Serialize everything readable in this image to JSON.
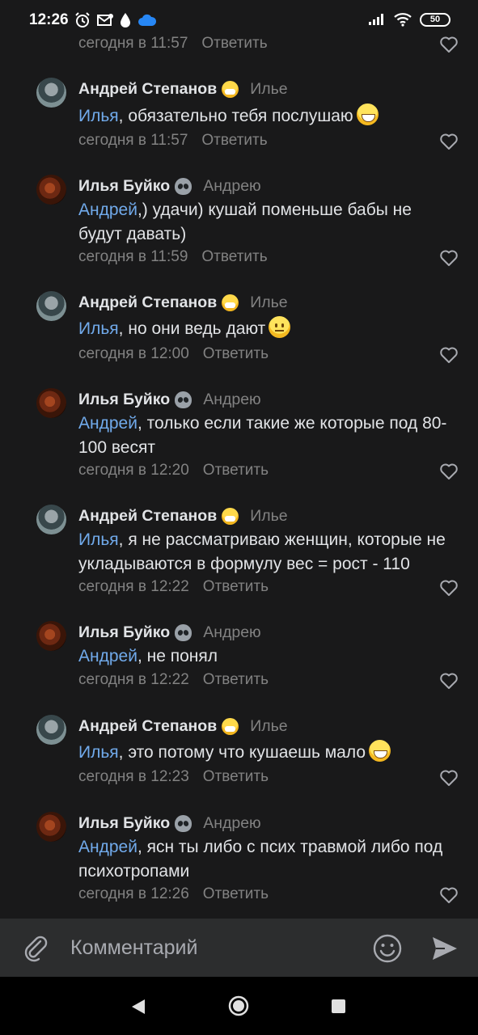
{
  "status_bar": {
    "time": "12:26",
    "battery": "50",
    "left_icons": [
      "alarm-icon",
      "mail-icon",
      "drop-icon",
      "cloud-icon"
    ],
    "right_icons": [
      "signal-icon",
      "wifi-icon",
      "battery-icon"
    ]
  },
  "colors": {
    "background": "#19191a",
    "mention": "#71aaeb",
    "meta": "#828282",
    "input_bar": "#2c2d2e"
  },
  "top_partial_comment": {
    "time": "сегодня в 11:57",
    "reply_label": "Ответить"
  },
  "comments": [
    {
      "author": "Андрей Степанов",
      "badge": "mask-emoji",
      "reply_to": "Илье",
      "mention": "Илья",
      "text": ", обязательно тебя послушаю",
      "emoji": "grin",
      "time": "сегодня в 11:57",
      "reply_label": "Ответить"
    },
    {
      "author": "Илья Буйко",
      "badge": "alien-emoji",
      "reply_to": "Андрею",
      "mention": "Андрей",
      "text": ",) удачи) кушай поменьше бабы не будут давать)",
      "emoji": "",
      "time": "сегодня в 11:59",
      "reply_label": "Ответить"
    },
    {
      "author": "Андрей Степанов",
      "badge": "mask-emoji",
      "reply_to": "Илье",
      "mention": "Илья",
      "text": ", но они ведь дают",
      "emoji": "neutral",
      "time": "сегодня в 12:00",
      "reply_label": "Ответить"
    },
    {
      "author": "Илья Буйко",
      "badge": "alien-emoji",
      "reply_to": "Андрею",
      "mention": "Андрей",
      "text": ", только если такие же которые под 80-100 весят",
      "emoji": "",
      "time": "сегодня в 12:20",
      "reply_label": "Ответить"
    },
    {
      "author": "Андрей Степанов",
      "badge": "mask-emoji",
      "reply_to": "Илье",
      "mention": "Илья",
      "text": ", я не рассматриваю женщин, которые не укладываются в формулу вес = рост - 110",
      "emoji": "",
      "time": "сегодня в 12:22",
      "reply_label": "Ответить"
    },
    {
      "author": "Илья Буйко",
      "badge": "alien-emoji",
      "reply_to": "Андрею",
      "mention": "Андрей",
      "text": ", не понял",
      "emoji": "",
      "time": "сегодня в 12:22",
      "reply_label": "Ответить"
    },
    {
      "author": "Андрей Степанов",
      "badge": "mask-emoji",
      "reply_to": "Илье",
      "mention": "Илья",
      "text": ", это потому что кушаешь мало",
      "emoji": "grin",
      "time": "сегодня в 12:23",
      "reply_label": "Ответить"
    },
    {
      "author": "Илья Буйко",
      "badge": "alien-emoji",
      "reply_to": "Андрею",
      "mention": "Андрей",
      "text": ", ясн ты либо с псих травмой либо под психотропами",
      "emoji": "",
      "time": "сегодня в 12:26",
      "reply_label": "Ответить"
    }
  ],
  "input_bar": {
    "placeholder": "Комментарий",
    "icons": [
      "paperclip-icon",
      "smile-icon",
      "send-icon"
    ]
  },
  "nav_bar": {
    "icons": [
      "back-icon",
      "home-icon",
      "recents-icon"
    ]
  }
}
